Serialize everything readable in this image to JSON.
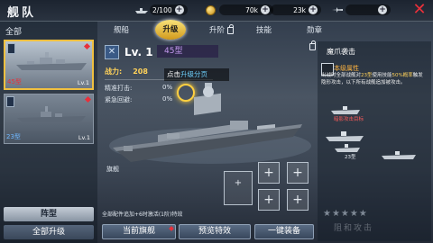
{
  "header": {
    "title": "舰队",
    "stamina": "2/100",
    "gold": "70k",
    "silver": "23k"
  },
  "left": {
    "category": "全部",
    "ships": [
      {
        "type": "45型",
        "level": "Lv.1",
        "selected": true,
        "type_color": "#e8303a"
      },
      {
        "type": "23型",
        "level": "Lv.1",
        "selected": false,
        "type_color": "#6fb7ff"
      }
    ],
    "formation_button": "阵型",
    "upgrade_all_button": "全部升级"
  },
  "tabs": [
    "舰船",
    "升级",
    "升阶",
    "技能",
    "勋章"
  ],
  "stats": {
    "level": "Lv. 1",
    "rank": "45型",
    "power_label": "战力:",
    "power_value": "208",
    "precision_label": "精准打击:",
    "precision_value": "0%",
    "evasion_label": "紧急回避:",
    "evasion_value": "0%"
  },
  "hint": {
    "prefix": "点击",
    "highlight": "升级分页"
  },
  "flag_label": "旗舰",
  "note": "全部配件追加+6时激活(1阶)特效",
  "bottom_buttons": [
    "当前旗舰",
    "预览特效",
    "一键装备"
  ],
  "skill": {
    "name": "魔爪袭击",
    "effect_title": "本级属性",
    "desc_part1": "出战时全部战舰对",
    "desc_highlight1": "23型",
    "desc_part2": "使用技能",
    "desc_highlight2": "50%概率",
    "desc_part3": "触发隐形攻击，以下所有战舰追加被攻击。",
    "label_a": "暗影攻击目标",
    "label_b": "23型",
    "stars": "★★★★★",
    "joint": "阻和攻击"
  }
}
